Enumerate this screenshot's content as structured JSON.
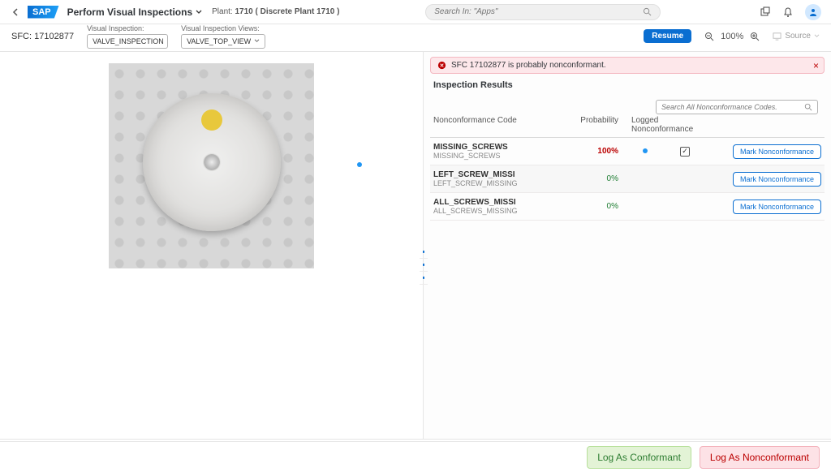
{
  "shell": {
    "logo_text": "SAP",
    "page_title": "Perform Visual Inspections",
    "plant_label": "Plant:",
    "plant_value": "1710 ( Discrete Plant 1710 )",
    "search_placeholder": "Search In: \"Apps\""
  },
  "subheader": {
    "sfc_label": "SFC:",
    "sfc_value": "17102877",
    "visual_inspection_label": "Visual Inspection:",
    "visual_inspection_value": "VALVE_INSPECTION",
    "view_label": "Visual Inspection Views:",
    "view_value": "VALVE_TOP_VIEW",
    "resume_btn": "Resume",
    "zoom_level": "100%",
    "source_label": "Source"
  },
  "banner": {
    "text": "SFC 17102877 is probably nonconformant."
  },
  "results": {
    "title": "Inspection Results",
    "search_placeholder": "Search All Nonconformance Codes.",
    "columns": {
      "code": "Nonconformance Code",
      "probability": "Probability",
      "logged": "Logged Nonconformance"
    },
    "rows": [
      {
        "code": "MISSING_SCREWS",
        "desc": "MISSING_SCREWS",
        "probability": "100%",
        "prob_class": "prob-red",
        "dot": true,
        "checked": true,
        "action": "Mark Nonconformance"
      },
      {
        "code": "LEFT_SCREW_MISSI",
        "desc": "LEFT_SCREW_MISSING",
        "probability": "0%",
        "prob_class": "prob-green",
        "dot": false,
        "checked": false,
        "action": "Mark Nonconformance"
      },
      {
        "code": "ALL_SCREWS_MISSI",
        "desc": "ALL_SCREWS_MISSING",
        "probability": "0%",
        "prob_class": "prob-green",
        "dot": false,
        "checked": false,
        "action": "Mark Nonconformance"
      }
    ]
  },
  "footer": {
    "conformant": "Log As Conformant",
    "nonconformant": "Log As Nonconformant"
  }
}
